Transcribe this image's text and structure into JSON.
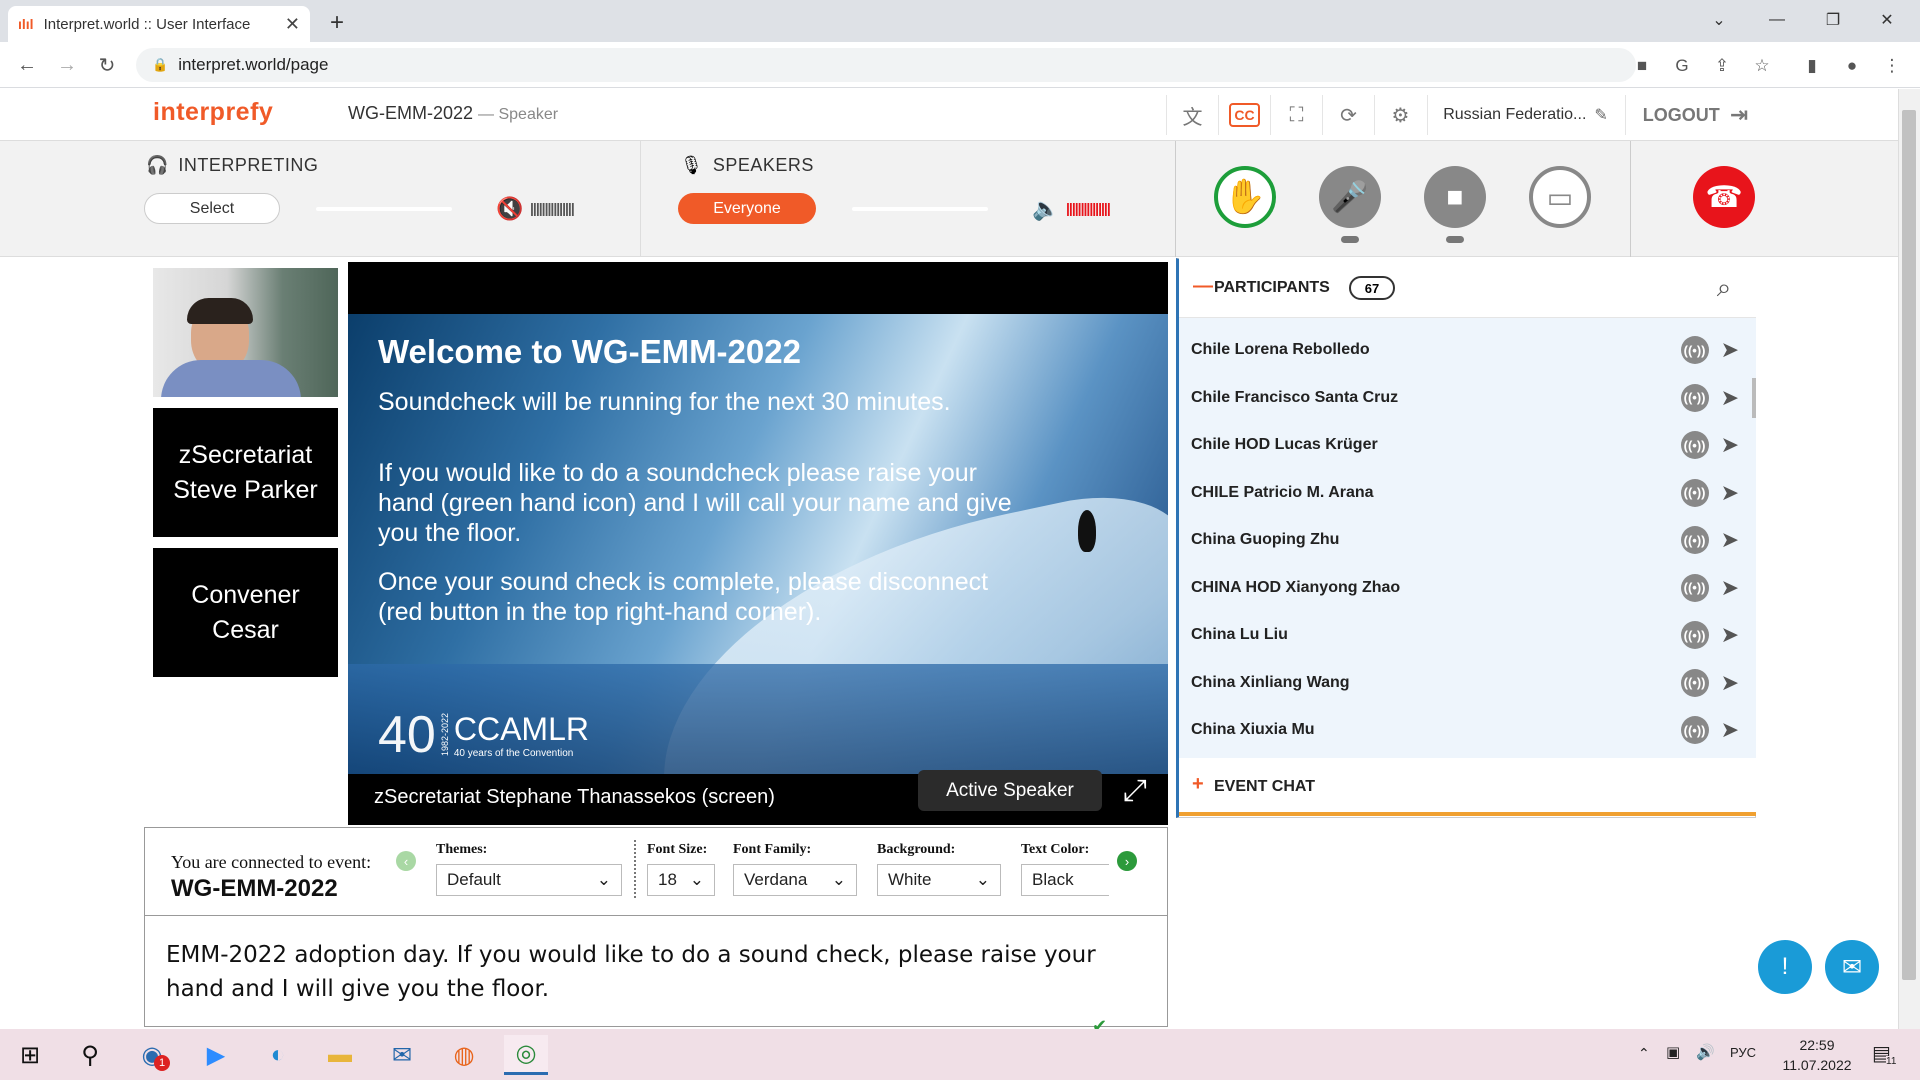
{
  "browser": {
    "tab_title": "Interpret.world :: User Interface",
    "url": "interpret.world/page"
  },
  "app": {
    "logo": "interprefy",
    "event_name": "WG-EMM-2022",
    "role": "— Speaker",
    "country": "Russian Federatio...",
    "logout_label": "LOGOUT",
    "cc_label": "CC"
  },
  "interpreting": {
    "label": "INTERPRETING",
    "select_label": "Select"
  },
  "speakers": {
    "label": "SPEAKERS",
    "everyone_label": "Everyone"
  },
  "tiles": [
    {
      "line1": "zSecretariat",
      "line2": "Steve Parker"
    },
    {
      "line1": "Convener",
      "line2": "Cesar"
    }
  ],
  "slide": {
    "title": "Welcome to WG-EMM-2022",
    "p1": "Soundcheck will be running for the next 30 minutes.",
    "p2": "If you would like to do a soundcheck please raise your hand (green hand icon) and I will call your name and give you the floor.",
    "p3": "Once your sound check is complete, please disconnect (red button in the top right-hand corner).",
    "logo_number": "40",
    "logo_years": "1982-2022",
    "logo_name": "CCAMLR",
    "logo_tagline": "40 years of the Convention"
  },
  "stage": {
    "screen_label": "zSecretariat Stephane Thanassekos (screen)",
    "active_speaker": "Active Speaker"
  },
  "captions": {
    "connected_text": "You are connected to event:",
    "event": "WG-EMM-2022",
    "themes_label": "Themes:",
    "themes_value": "Default",
    "font_size_label": "Font Size:",
    "font_size_value": "18",
    "font_family_label": "Font Family:",
    "font_family_value": "Verdana",
    "background_label": "Background:",
    "background_value": "White",
    "text_color_label": "Text Color:",
    "text_color_value": "Black",
    "text": "EMM-2022 adoption day. If you would like to do a sound check, please raise your hand and I will give you the floor."
  },
  "participants": {
    "title": "PARTICIPANTS",
    "count": "67",
    "items": [
      "Chile Lorena Rebolledo",
      "Chile Francisco Santa Cruz",
      "Chile HOD Lucas Krüger",
      "CHILE Patricio M. Arana",
      "China Guoping Zhu",
      "CHINA HOD Xianyong Zhao",
      "China Lu Liu",
      "China Xinliang Wang",
      "China Xiuxia Mu"
    ]
  },
  "event_chat": {
    "label": "EVENT CHAT"
  },
  "taskbar": {
    "lang": "РУС",
    "time": "22:59",
    "date": "11.07.2022",
    "mail_badge": "1",
    "notif_badge": "11"
  },
  "colors": {
    "brand": "#f05a28",
    "hangup": "#e8141b",
    "raise_hand": "#1d9e3a",
    "accent_blue": "#1a9bd7"
  }
}
